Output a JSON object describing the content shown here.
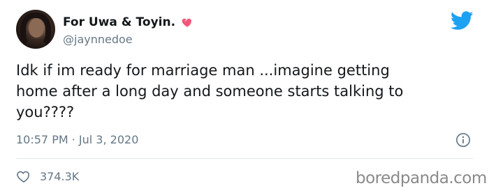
{
  "user": {
    "display_name": "For Uwa & Toyin.",
    "handle": "@jaynnedoe"
  },
  "tweet": {
    "text": "Idk if im ready for marriage man ...imagine getting\nhome after a long day and someone starts talking to\nyou????",
    "timestamp": "10:57 PM · Jul 3, 2020"
  },
  "stats": {
    "likes": "374.3K"
  },
  "watermark": "boredpanda.com",
  "icons": {
    "heart_emoji": "sparkling-heart-icon",
    "brand": "twitter-bird-icon",
    "info": "info-icon",
    "like": "heart-outline-icon"
  },
  "colors": {
    "brand_blue": "#1da1f2",
    "heart_pink": "#f2577a",
    "muted": "#657786"
  }
}
